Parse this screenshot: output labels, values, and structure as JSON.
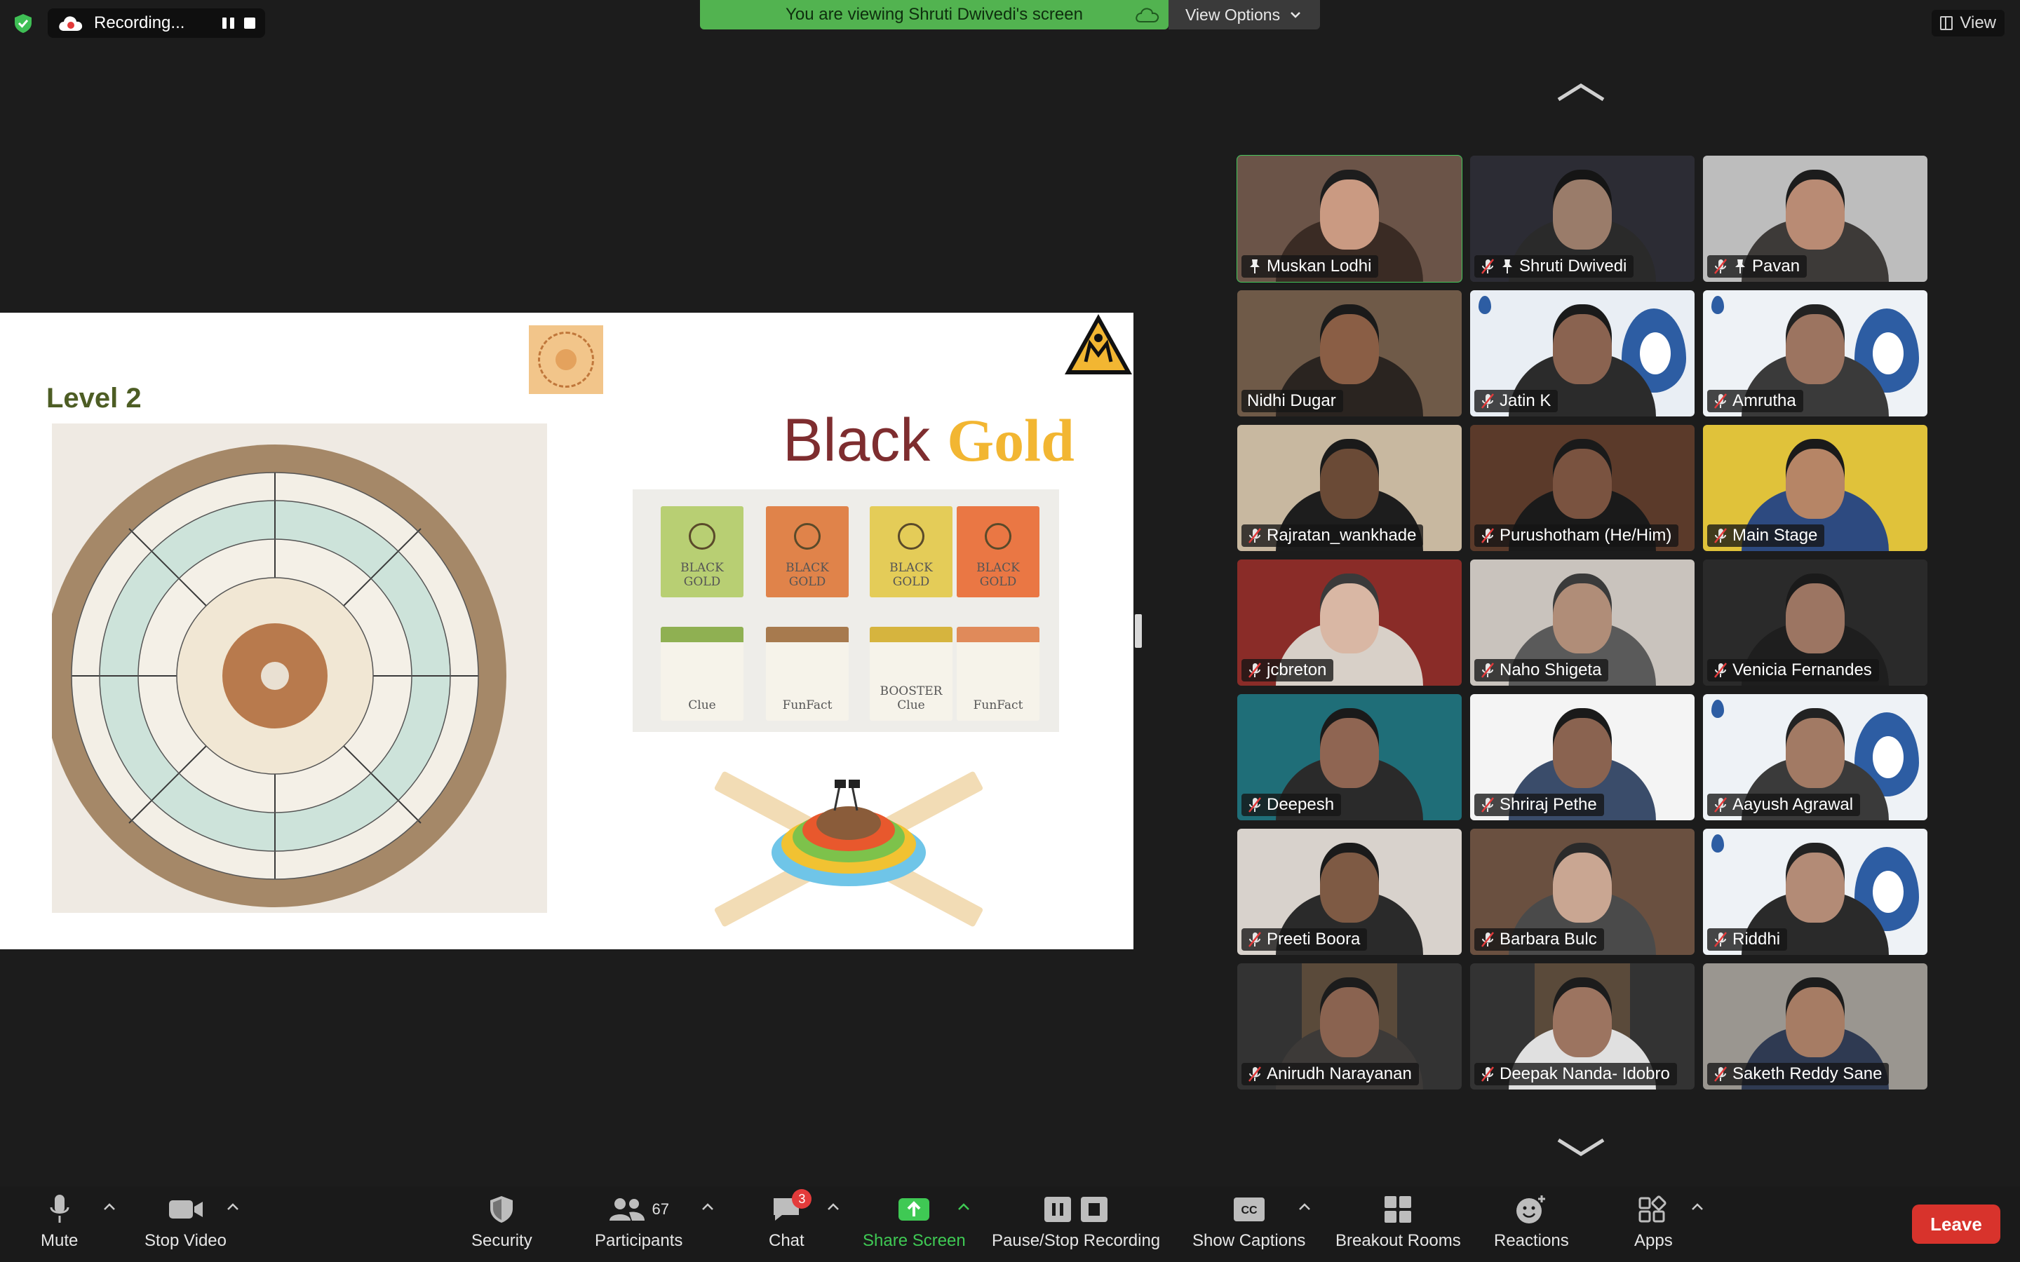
{
  "top_bar": {
    "recording_label": "Recording...",
    "viewing_banner": "You are viewing Shruti Dwivedi's screen",
    "view_options_label": "View Options",
    "view_label": "View"
  },
  "slide": {
    "level_label": "Level 2",
    "title_word_1": "Black",
    "title_word_2": "Gold"
  },
  "gallery": {
    "tiles": [
      {
        "name": "Muskan Lodhi",
        "muted": false,
        "pinned": true,
        "active": true
      },
      {
        "name": "Shruti Dwivedi",
        "muted": true,
        "pinned": true,
        "active": false
      },
      {
        "name": "Pavan",
        "muted": true,
        "pinned": true,
        "active": false
      },
      {
        "name": "Nidhi Dugar",
        "muted": false,
        "pinned": false,
        "active": false
      },
      {
        "name": "Jatin K",
        "muted": true,
        "pinned": false,
        "active": false
      },
      {
        "name": "Amrutha",
        "muted": true,
        "pinned": false,
        "active": false
      },
      {
        "name": "Rajratan_wankhade",
        "muted": true,
        "pinned": false,
        "active": false
      },
      {
        "name": "Purushotham (He/Him)",
        "muted": true,
        "pinned": false,
        "active": false
      },
      {
        "name": "Main Stage",
        "muted": true,
        "pinned": false,
        "active": false
      },
      {
        "name": "jcbreton",
        "muted": true,
        "pinned": false,
        "active": false
      },
      {
        "name": "Naho Shigeta",
        "muted": true,
        "pinned": false,
        "active": false
      },
      {
        "name": "Venicia Fernandes",
        "muted": true,
        "pinned": false,
        "active": false
      },
      {
        "name": "Deepesh",
        "muted": true,
        "pinned": false,
        "active": false
      },
      {
        "name": "Shriraj Pethe",
        "muted": true,
        "pinned": false,
        "active": false
      },
      {
        "name": "Aayush Agrawal",
        "muted": true,
        "pinned": false,
        "active": false
      },
      {
        "name": "Preeti Boora",
        "muted": true,
        "pinned": false,
        "active": false
      },
      {
        "name": "Barbara Bulc",
        "muted": true,
        "pinned": false,
        "active": false
      },
      {
        "name": "Riddhi",
        "muted": true,
        "pinned": false,
        "active": false
      },
      {
        "name": "Anirudh Narayanan",
        "muted": true,
        "pinned": false,
        "active": false
      },
      {
        "name": "Deepak Nanda- Idobro",
        "muted": true,
        "pinned": false,
        "active": false
      },
      {
        "name": "Saketh Reddy Sane",
        "muted": true,
        "pinned": false,
        "active": false
      }
    ]
  },
  "toolbar": {
    "mute_label": "Mute",
    "stop_video_label": "Stop Video",
    "security_label": "Security",
    "participants_label": "Participants",
    "participants_count": "67",
    "chat_label": "Chat",
    "chat_badge": "3",
    "share_screen_label": "Share Screen",
    "pause_stop_recording_label": "Pause/Stop Recording",
    "show_captions_label": "Show Captions",
    "cc_glyph": "CC",
    "breakout_rooms_label": "Breakout Rooms",
    "reactions_label": "Reactions",
    "apps_label": "Apps",
    "leave_label": "Leave"
  },
  "colors": {
    "active_speaker": "#43c65b",
    "viewing_banner_bg": "#52b350",
    "leave_button": "#d8332c",
    "share_screen": "#3fc954",
    "chat_badge": "#e33b3b"
  }
}
